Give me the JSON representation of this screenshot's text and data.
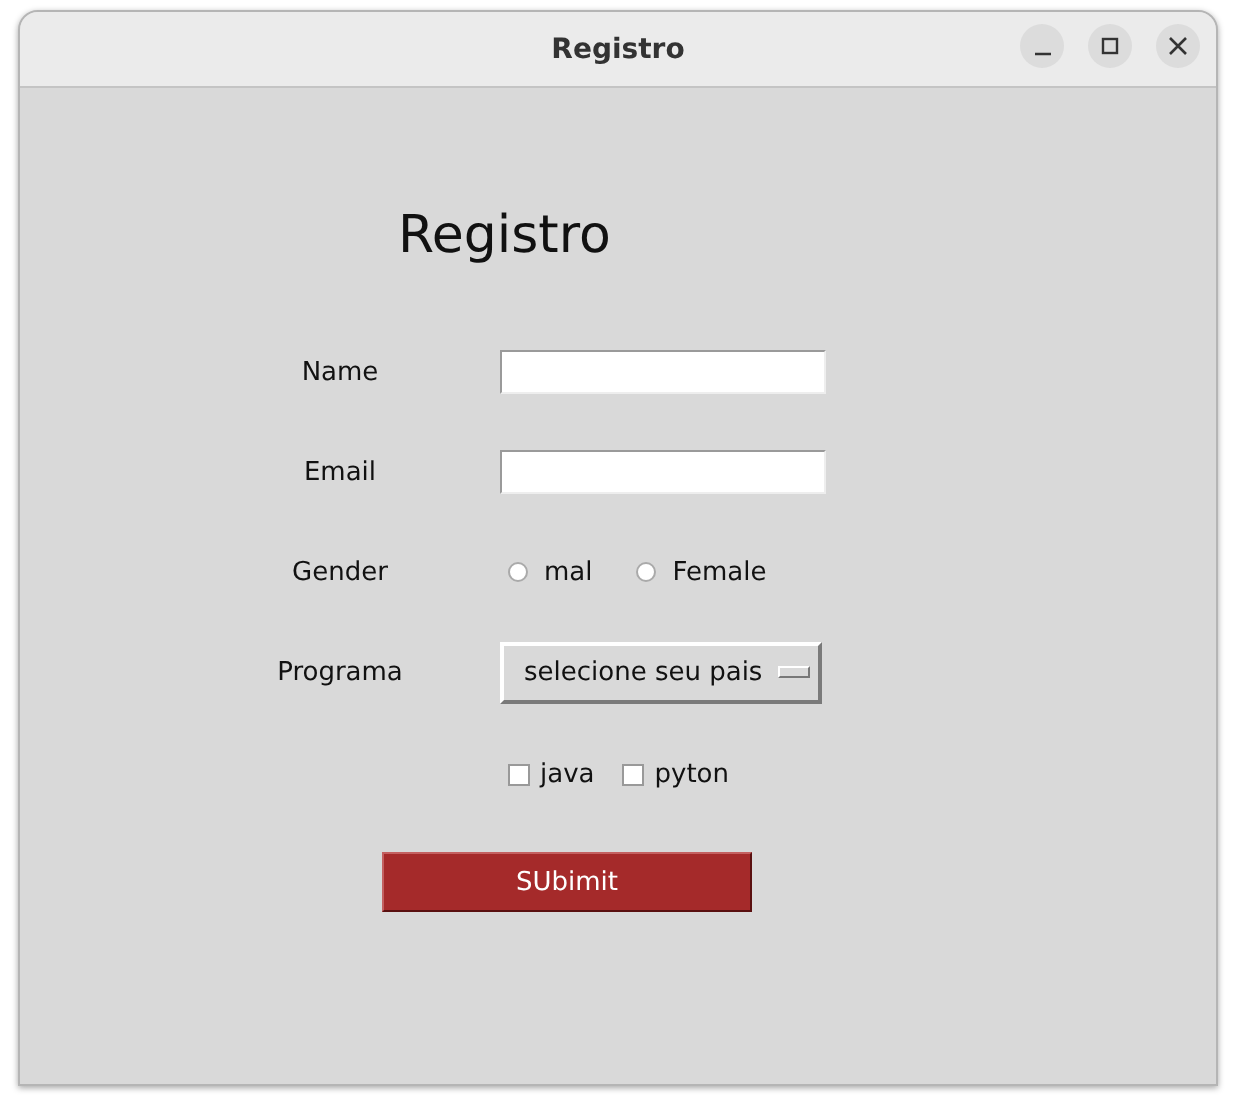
{
  "window": {
    "title": "Registro"
  },
  "heading": "Registro",
  "fields": [
    {
      "label": "Name"
    },
    {
      "label": "Email"
    }
  ],
  "gender": {
    "label": "Gender",
    "options": [
      {
        "label": "mal",
        "selected": false
      },
      {
        "label": "Female",
        "selected": false
      }
    ]
  },
  "programa": {
    "label": "Programa",
    "dropdown": "selecione seu pais"
  },
  "checkboxes": [
    {
      "label": "java",
      "checked": false
    },
    {
      "label": "pyton",
      "checked": false
    }
  ],
  "submit": "SUbimit"
}
